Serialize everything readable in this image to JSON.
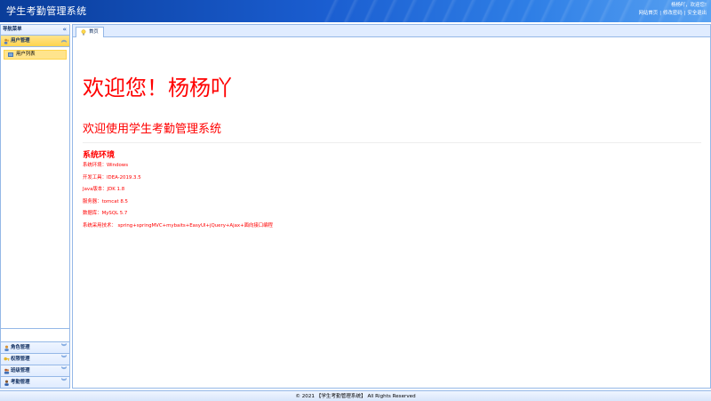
{
  "header": {
    "title": "学生考勤管理系统",
    "greeting": "杨杨吖，欢迎您!",
    "links": [
      "网站首页",
      "修改密码",
      "安全退出"
    ]
  },
  "sidebar": {
    "title": "导航菜单",
    "collapse_icon": "«",
    "panels": [
      {
        "label": "用户管理",
        "icon": "user-group-icon",
        "expanded": true,
        "items": [
          "用户列表"
        ]
      },
      {
        "label": "角色管理",
        "icon": "role-icon",
        "expanded": false
      },
      {
        "label": "权限管理",
        "icon": "key-icon",
        "expanded": false
      },
      {
        "label": "班级管理",
        "icon": "class-icon",
        "expanded": false
      },
      {
        "label": "考勤管理",
        "icon": "attendance-icon",
        "expanded": false
      }
    ]
  },
  "tabs": [
    {
      "label": "首页",
      "icon": "bulb-icon"
    }
  ],
  "main": {
    "welcome": "欢迎您！杨杨吖",
    "subtitle": "欢迎使用学生考勤管理系统",
    "env_title": "系统环境",
    "env": [
      "系统环境：Windows",
      "开发工具：IDEA-2019.3.5",
      "Java版本：JDK 1.8",
      "服务器：tomcat 8.5",
      "数据库：MySQL 5.7",
      "系统采用技术： spring+springMVC+mybaits+EasyUI+jQuery+Ajax+面向接口编程"
    ]
  },
  "footer": {
    "text": "© 2021 【学生考勤管理系统】 All Rights Reserved"
  },
  "colors": {
    "accent": "#ff0000",
    "header_start": "#0a3d9a",
    "border": "#95b8e7",
    "active": "#ffe48d"
  }
}
